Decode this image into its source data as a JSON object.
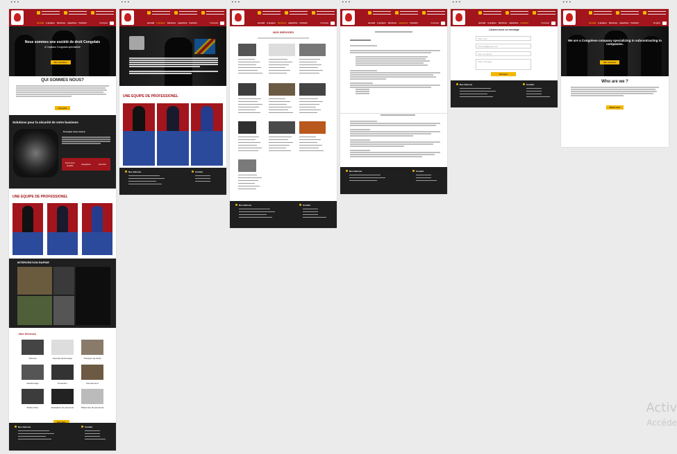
{
  "frames": {
    "dots": "•••"
  },
  "header": {
    "nav": [
      "accueil",
      "a propos",
      "Services",
      "expertise",
      "Contact"
    ],
    "lang": "Français",
    "lang_en": "English"
  },
  "frame1": {
    "hero_title": "Nous sommes une société de droit Congolais",
    "hero_subtitle": "A Capitaux Congolais spécialisée",
    "hero_button": "Nos services",
    "about_title": "QUI SOMMES NOUS?",
    "about_button": "Lire plus",
    "security_title": "Solutions pour la sécurité de votre business",
    "why_title": "Pourquoi nous choisir",
    "why_items": [
      "Personnel qualifié",
      "Intégration",
      "Sécurité"
    ],
    "team_title": "UNE EQUIPE DE PROFESSIONEL",
    "rapid_title": "INTERVENTION RAPIDE",
    "services_title": "Nos Services",
    "services": [
      "Sécurité",
      "Sécurité électronique",
      "Transport de fonds",
      "Gardiennage",
      "Protection",
      "Recrutement",
      "Maître-chien",
      "Evaluation du personnel",
      "Placement de personnel"
    ],
    "services_button": "Voir plus",
    "footer_address": "Nos Adresse",
    "footer_contact": "Contact"
  },
  "frame2": {
    "team_title": "UNE EQUIPE DE PROFESSIONEL",
    "footer_address": "Nos Adresse",
    "footer_contact": "Contact"
  },
  "frame3": {
    "title": "NOS SERVICES",
    "footer_address": "Nos Adresse",
    "footer_contact": "Contact"
  },
  "frame4": {
    "footer_address": "Nos Adresse",
    "footer_contact": "Contact"
  },
  "frame5": {
    "form_title": "Laissez-nous un message",
    "fields": [
      "Votre nom",
      "votremail@gmail.com",
      "Votre company",
      "Votre message"
    ],
    "submit": "Envoyer",
    "footer_address": "Nos Adresse",
    "footer_contact": "Contact"
  },
  "frame6": {
    "hero_title": "We are a Congolese company specializing in subcontracting to companies.",
    "hero_button": "Our services",
    "about_title": "Who are we ?",
    "about_button": "Read more"
  },
  "watermark": {
    "line1": "Activ",
    "line2": "Accéde"
  }
}
